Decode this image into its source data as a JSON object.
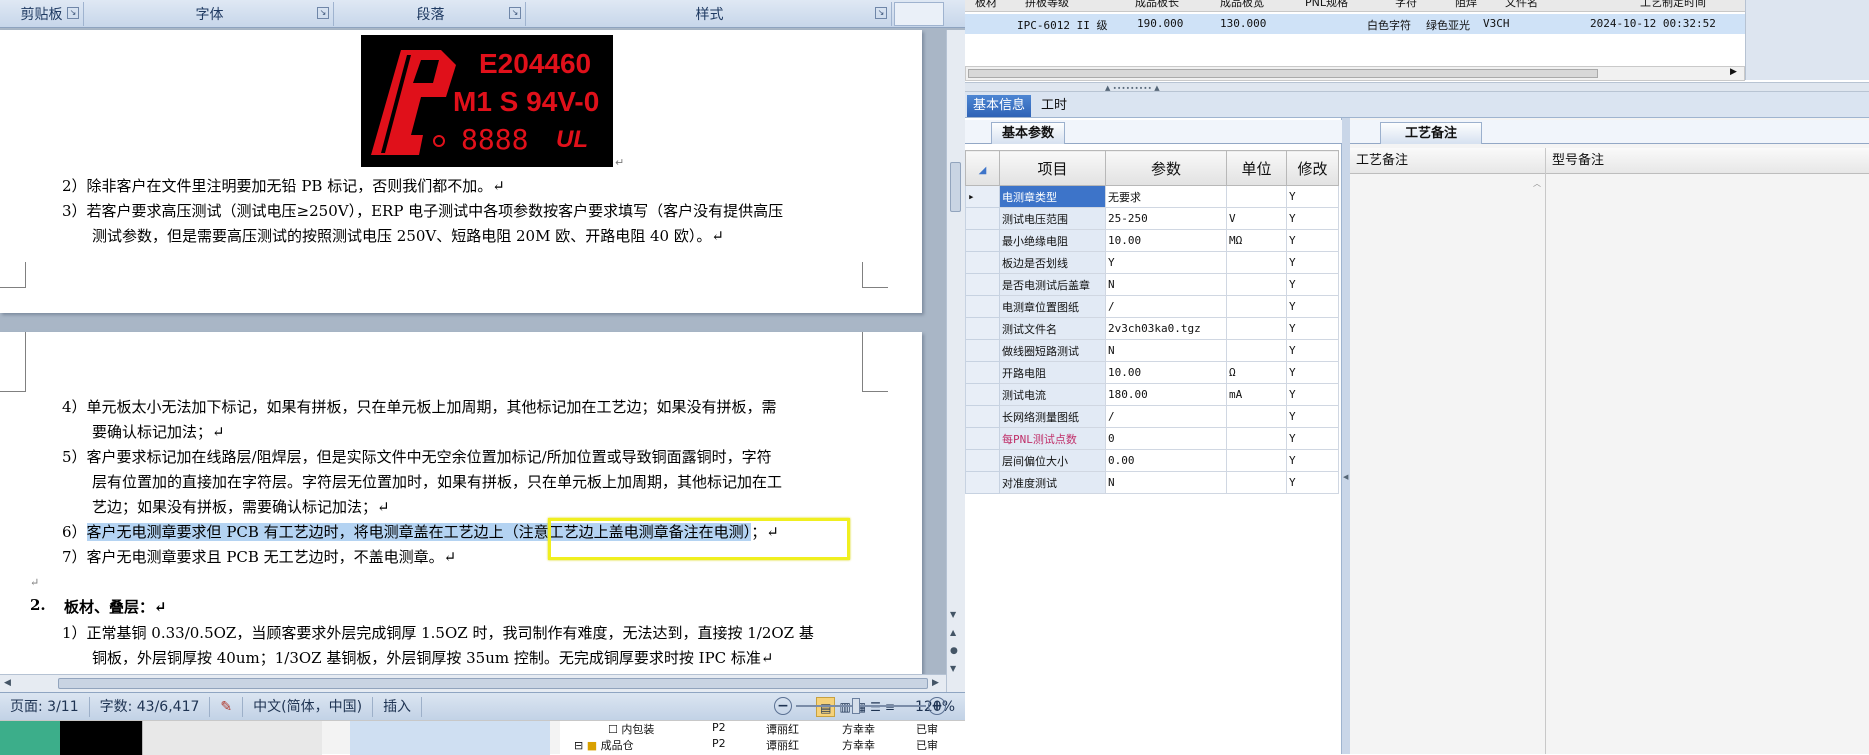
{
  "word": {
    "ribbon_groups": [
      "剪贴板",
      "字体",
      "段落",
      "样式"
    ],
    "page1_lines": [
      "2）除非客户在文件里注明要加无铅 PB 标记，否则我们都不加。↵",
      "3）若客户要求高压测试（测试电压≥250V），ERP 电子测试中各项参数按客户要求填写（客户没有提供高压",
      "测试参数，但是需要高压测试的按照测试电压 250V、短路电阻 20M 欧、开路电阻 40 欧）。↵"
    ],
    "logo": {
      "line1": "E204460",
      "line2": "M1 S 94V-0",
      "line3": "8888",
      "ul": "UL"
    },
    "page2": {
      "l4a": "4）单元板太小无法加下标记，如果有拼板，只在单元板上加周期，其他标记加在工艺边；如果没有拼板，需",
      "l4b": "要确认标记加法；↵",
      "l5a": "5）客户要求标记加在线路层/阻焊层，但是实际文件中无空余位置加标记/所加位置或导致铜面露铜时，字符",
      "l5b": "层有位置加的直接加在字符层。字符层无位置加时，如果有拼板，只在单元板上加周期，其他标记加在工",
      "l5c": "艺边；如果没有拼板，需要确认标记加法；↵",
      "l6_prefix": "6）",
      "l6_sel": "客户无电测章要求但 PCB 有工艺边时，将电测章盖在工艺边上（注意工艺边上盖电测章备注在电测）",
      "l6_end": "；↵",
      "l7": "7）客户无电测章要求且 PCB 无工艺边时，不盖电测章。↵",
      "blank": "↵",
      "h2_num": "2.",
      "h2_text": "板材、叠层：↵",
      "b1a": "1）正常基铜 0.33/0.5OZ，当顾客要求外层完成铜厚 1.5OZ 时，我司制作有难度，无法达到，直接按 1/2OZ 基",
      "b1b": "铜板，外层铜厚按 40um；1/3OZ 基铜板，外层铜厚按 35um 控制。无完成铜厚要求时按 IPC 标准↵"
    },
    "status": {
      "page": "页面: 3/11",
      "words": "字数: 43/6,417",
      "lang": "中文(简体，中国)",
      "mode": "插入",
      "zoom": "120%"
    },
    "tree_items": [
      {
        "label": "内包装",
        "c1": "P2",
        "c2": "谭丽红",
        "c3": "方幸幸",
        "c4": "已审"
      },
      {
        "label": "成品仓",
        "c1": "P2",
        "c2": "谭丽红",
        "c3": "方幸幸",
        "c4": "已审"
      }
    ]
  },
  "erp": {
    "top_headers": [
      "板材",
      "拼板等级",
      "成品板长",
      "成品板宽",
      "PNL规格",
      "字符",
      "阻焊",
      "文件名",
      "工艺制定时间"
    ],
    "top_row": {
      "grade": "IPC-6012 II 级",
      "len": "190.000",
      "wid": "130.000",
      "char": "白色字符",
      "mask": "绿色亚光",
      "file": "V3CH",
      "time": "2024-10-12 00:32:52"
    },
    "tabs": [
      "基本信息",
      "工时"
    ],
    "left_subtab": "基本参数",
    "right_subtab": "工艺备注",
    "grid_headers": [
      "项目",
      "参数",
      "单位",
      "修改"
    ],
    "grid_rows": [
      {
        "item": "电测章类型",
        "param": "无要求",
        "unit": "",
        "mod": "Y"
      },
      {
        "item": "测试电压范围",
        "param": "25-250",
        "unit": "V",
        "mod": "Y"
      },
      {
        "item": "最小绝缘电阻",
        "param": "10.00",
        "unit": "MΩ",
        "mod": "Y"
      },
      {
        "item": "板边是否划线",
        "param": "Y",
        "unit": "",
        "mod": "Y"
      },
      {
        "item": "是否电测试后盖章",
        "param": "N",
        "unit": "",
        "mod": "Y"
      },
      {
        "item": "电测章位置图纸",
        "param": "/",
        "unit": "",
        "mod": "Y"
      },
      {
        "item": "测试文件名",
        "param": "2v3ch03ka0.tgz",
        "unit": "",
        "mod": "Y"
      },
      {
        "item": "做线圈短路测试",
        "param": "N",
        "unit": "",
        "mod": "Y"
      },
      {
        "item": "开路电阻",
        "param": "10.00",
        "unit": "Ω",
        "mod": "Y"
      },
      {
        "item": "测试电流",
        "param": "180.00",
        "unit": "mA",
        "mod": "Y"
      },
      {
        "item": "长网络测量图纸",
        "param": "/",
        "unit": "",
        "mod": "Y"
      },
      {
        "item": "每PNL测试点数",
        "param": "0",
        "unit": "",
        "mod": "Y"
      },
      {
        "item": "层间偏位大小",
        "param": "0.00",
        "unit": "",
        "mod": "Y"
      },
      {
        "item": "对准度测试",
        "param": "N",
        "unit": "",
        "mod": "Y"
      }
    ],
    "notes_headers": [
      "工艺备注",
      "型号备注"
    ],
    "colors": {
      "accent": "#3d74c9",
      "highlight": "#f0ef1f"
    }
  }
}
